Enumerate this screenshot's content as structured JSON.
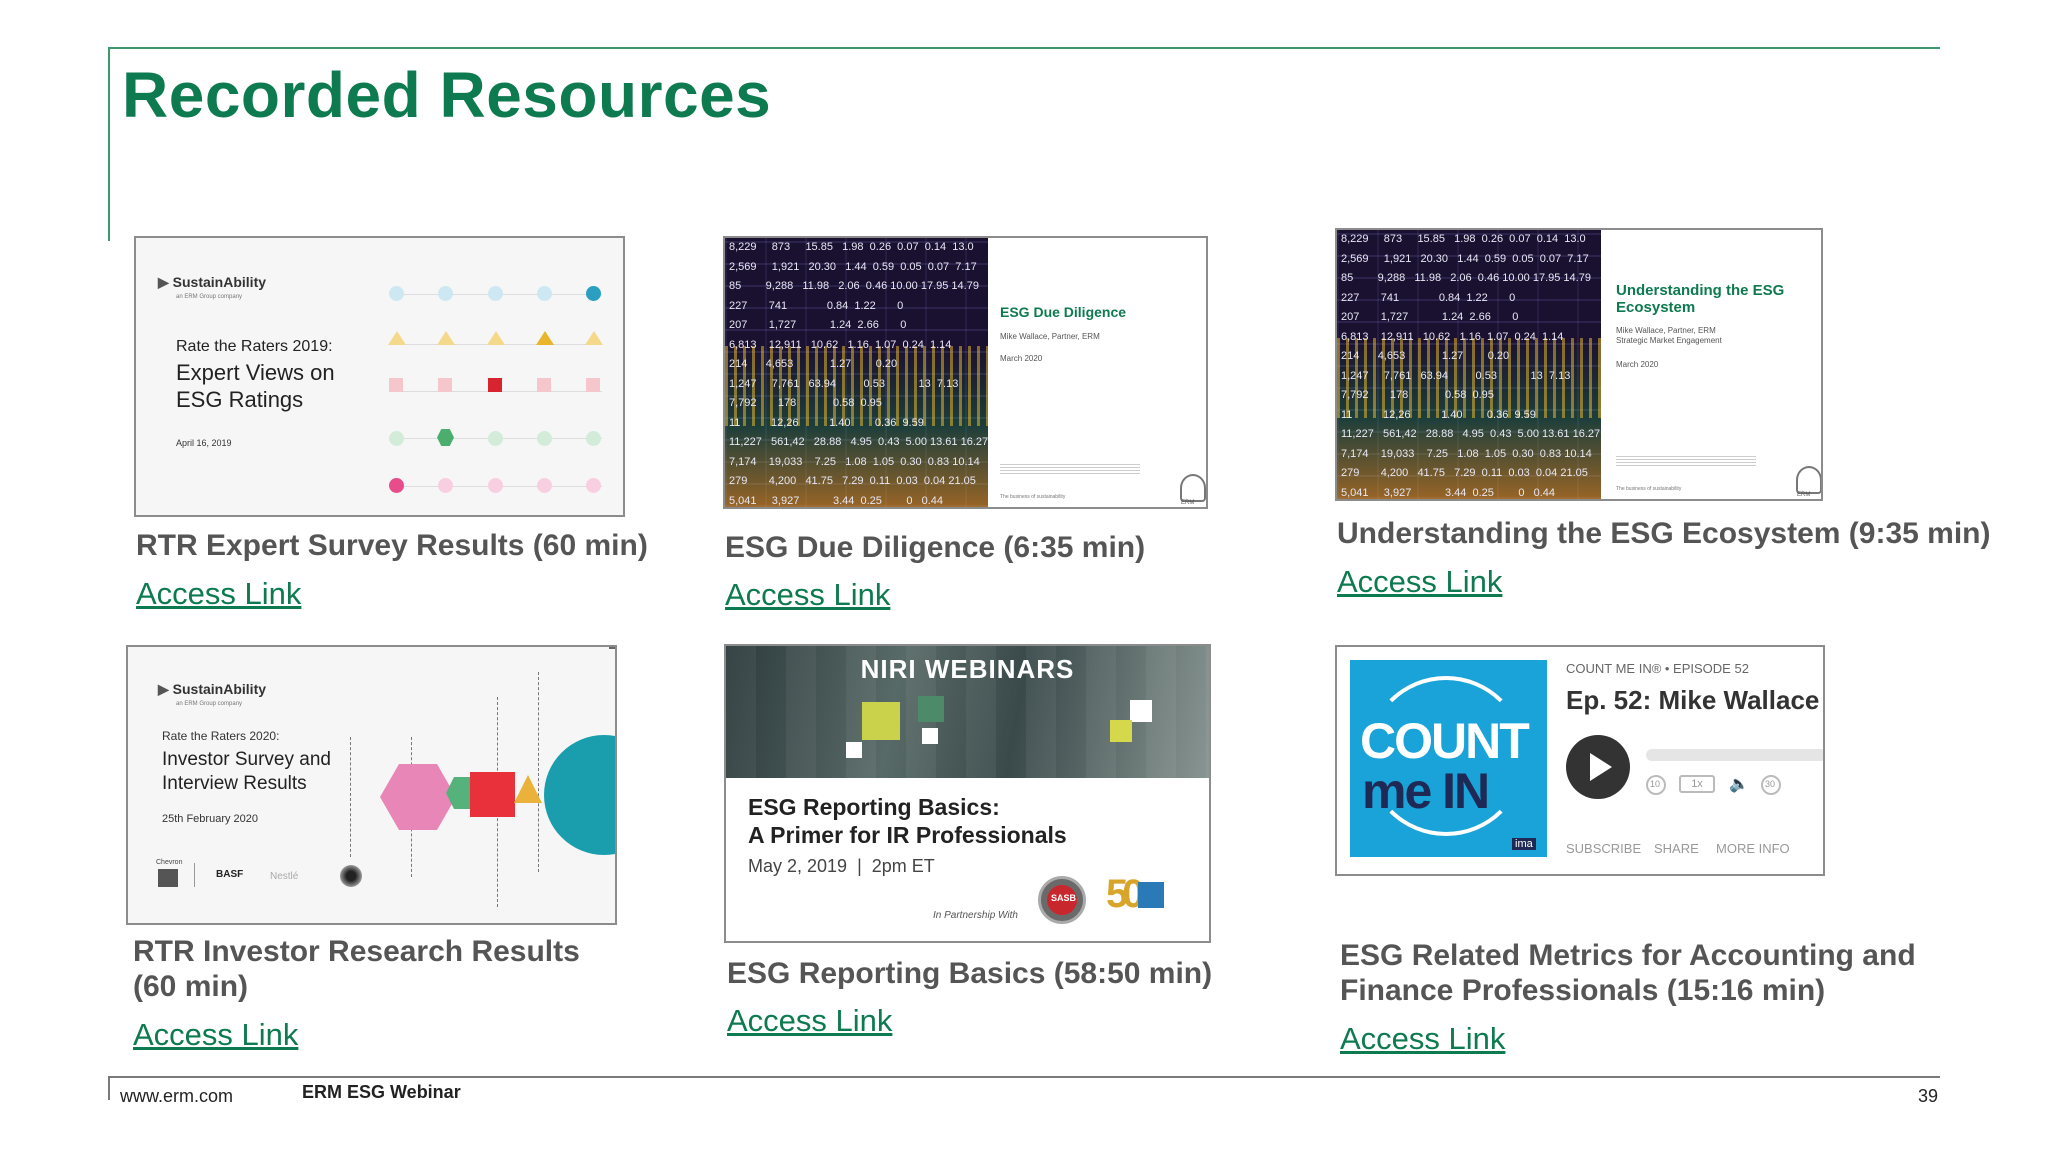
{
  "page": {
    "title": "Recorded Resources",
    "footer": {
      "url": "www.erm.com",
      "title": "ERM ESG Webinar",
      "page_number": "39"
    }
  },
  "resources": [
    {
      "caption": "RTR Expert Survey Results (60 min)",
      "link": "Access Link",
      "thumb": {
        "brand": "SustainAbility",
        "brand_sub": "an ERM Group company",
        "kicker": "Rate the Raters 2019:",
        "headline1": "Expert Views on",
        "headline2": "ESG Ratings",
        "date": "April 16, 2019"
      }
    },
    {
      "caption": "ESG Due Diligence (6:35 min)",
      "link": "Access Link",
      "thumb": {
        "title": "ESG Due Diligence",
        "presenter": "Mike Wallace, Partner, ERM",
        "date": "March 2020",
        "tagline": "The business of sustainability",
        "logo": "ERM"
      }
    },
    {
      "caption": "Understanding the ESG Ecosystem (9:35 min)",
      "link": "Access Link",
      "thumb": {
        "title1": "Understanding the ESG",
        "title2": "Ecosystem",
        "presenter": "Mike Wallace, Partner, ERM",
        "role": "Strategic Market Engagement",
        "date": "March 2020",
        "tagline": "The business of sustainability",
        "logo": "ERM"
      }
    },
    {
      "caption1": "RTR Investor Research Results",
      "caption2": "(60 min)",
      "link": "Access Link",
      "thumb": {
        "brand": "SustainAbility",
        "brand_sub": "an ERM Group company",
        "kicker": "Rate the Raters 2020:",
        "headline1": "Investor Survey and",
        "headline2": "Interview Results",
        "date": "25th February 2020",
        "logos": [
          "Chevron",
          "BASF",
          "Nestlé"
        ]
      }
    },
    {
      "caption": "ESG Reporting Basics (58:50 min)",
      "link": "Access Link",
      "thumb": {
        "banner": "NIRI WEBINARS",
        "title1": "ESG Reporting Basics:",
        "title2": "A Primer for IR Professionals",
        "date": "May 2, 2019  |  2pm ET",
        "partner": "In Partnership With",
        "sasb": "SASB",
        "anniv": "50"
      }
    },
    {
      "caption1": "ESG Related Metrics for Accounting and",
      "caption2": "Finance Professionals (15:16 min)",
      "link": "Access Link",
      "thumb": {
        "art_line1": "COUNT",
        "art_line2": "me IN",
        "art_badge": "ima",
        "episode": "COUNT ME IN® • EPISODE 52",
        "title": "Ep. 52: Mike Wallace",
        "rewind": "10",
        "speed": "1x",
        "forward": "30",
        "subscribe": "SUBSCRIBE",
        "share": "SHARE",
        "more": "MORE INFO"
      }
    }
  ],
  "stock_numbers": "8,229     873     15.85   1.98  0.26  0.07  0.14  13.0\n2,569     1,921   20.30   1.44  0.59  0.05  0.07  7.17\n85        9,288   11.98   2.06  0.46 10.00 17.95 14.79\n227       741             0.84  1.22       0\n207       1,727           1.24  2.66       0\n6,813    12,911   10.62   1.16  1.07  0.24  1.14\n214      4,653            1.27        0.20\n1,247     7,761   63.94         0.53           13  7.13\n7,792       178            0.58  0.95\n11          12,26          1.40        0.36  9.59\n11,227   561,42   28.88   4.95  0.43  5.00 13.61 16.27\n7,174    19,033    7.25   1.08  1.05  0.30  0.83 10.14\n279       4,200   41.75   7.29  0.11  0.03  0.04 21.05\n5,041     3,927           3.44  0.25        0   0.44",
  "colors": {
    "brand_green": "#0d7a4f",
    "caption_gray": "#555555",
    "podcast_blue": "#1aa3d9"
  }
}
